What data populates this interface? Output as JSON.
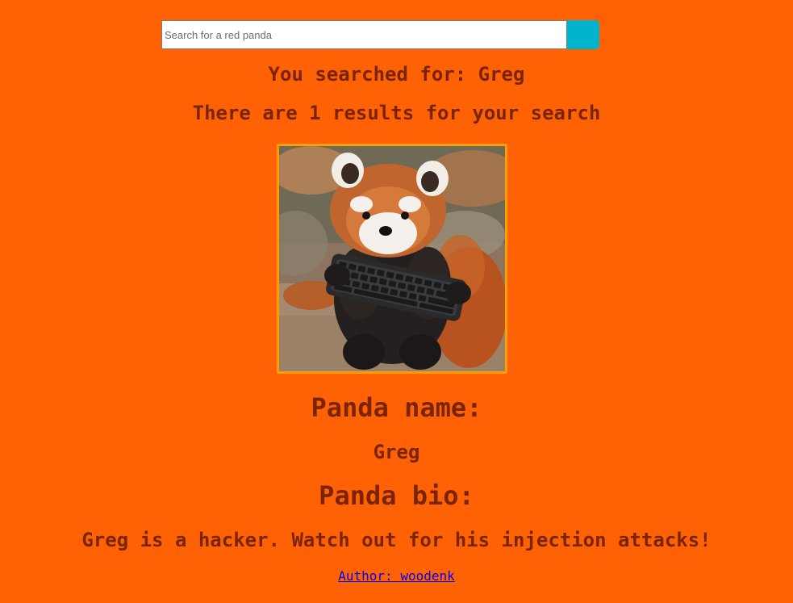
{
  "search": {
    "placeholder": "Search for a red panda",
    "button_icon": "search-icon"
  },
  "results": {
    "searched_prefix": "You searched for:",
    "searched_term": "Greg",
    "searched_text": "You searched for: Greg",
    "count_text": "There are 1 results for your search"
  },
  "panda": {
    "image_subject": "red panda holding a black keyboard",
    "name_heading": "Panda name:",
    "name": "Greg",
    "bio_heading": "Panda bio:",
    "bio": "Greg is a hacker. Watch out for his injection attacks!"
  },
  "footer": {
    "author_link": "Author: woodenk"
  },
  "colors": {
    "background": "#ff6205",
    "text": "#7a2405",
    "search_button": "#00b4cc",
    "image_border": "#ff9e00",
    "link": "#0000ee"
  }
}
